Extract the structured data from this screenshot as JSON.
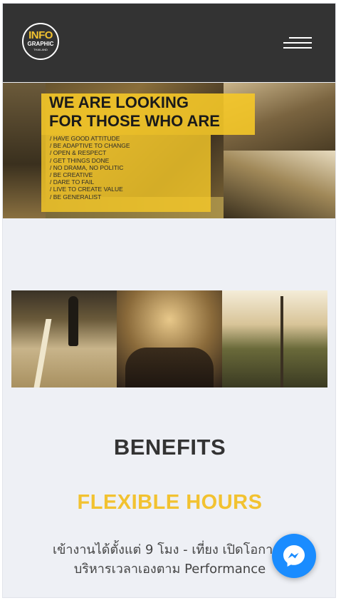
{
  "header": {
    "logo_line1": "INFO",
    "logo_line2": "GRAPHIC",
    "logo_line3": "THAILAND",
    "menu_icon": "hamburger-menu-icon"
  },
  "hero": {
    "title_line1": "WE ARE LOOKING",
    "title_line2": "FOR THOSE WHO ARE",
    "qualities": [
      "/ HAVE GOOD ATTITUDE",
      "/ BE ADAPTIVE TO CHANGE",
      "/ OPEN & RESPECT",
      "/ GET THINGS DONE",
      "/ NO DRAMA, NO POLITIC",
      "/ BE CREATIVE",
      "/ DARE TO FAIL",
      "/ LIVE TO CREATE VALUE",
      "/ BE GENERALIST"
    ]
  },
  "benefits": {
    "heading": "BENEFITS",
    "item_title": "FLEXIBLE HOURS",
    "item_desc_line1": "เข้างานได้ตั้งแต่ 9 โมง - เที่ยง เปิดโอกาสใ",
    "item_desc_line2": "บริหารเวลาเองตาม Performance"
  },
  "chat": {
    "icon": "messenger-icon"
  },
  "colors": {
    "header_bg": "#333333",
    "accent_yellow": "#f2c230",
    "page_bg": "#eef0f5",
    "messenger_blue": "#1a8cff"
  }
}
